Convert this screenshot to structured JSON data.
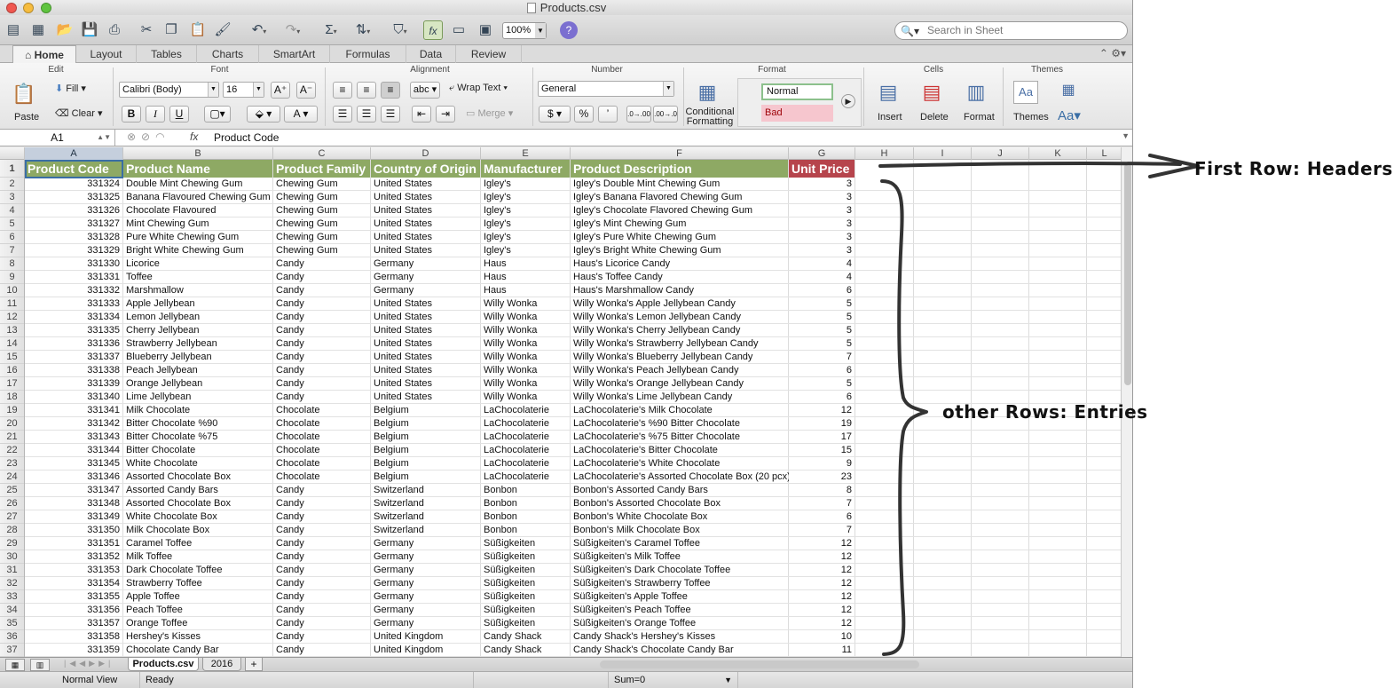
{
  "window": {
    "title": "Products.csv"
  },
  "toolbar": {
    "zoom": "100%",
    "search_placeholder": "Search in Sheet"
  },
  "ribbon_tabs": [
    "Home",
    "Layout",
    "Tables",
    "Charts",
    "SmartArt",
    "Formulas",
    "Data",
    "Review"
  ],
  "ribbon": {
    "groups": {
      "edit": "Edit",
      "font": "Font",
      "alignment": "Alignment",
      "number": "Number",
      "format": "Format",
      "cells": "Cells",
      "themes": "Themes"
    },
    "paste": "Paste",
    "fill": "Fill",
    "clear": "Clear",
    "font_name": "Calibri (Body)",
    "font_size": "16",
    "bold": "B",
    "italic": "I",
    "underline": "U",
    "abc": "abc",
    "wrap_text": "Wrap Text",
    "merge": "Merge",
    "number_format": "General",
    "percent": "%",
    "comma": "’",
    "inc_dec": ".0→.00",
    "dec_dec": ".00→.0",
    "conditional_formatting_1": "Conditional",
    "conditional_formatting_2": "Formatting",
    "style_normal": "Normal",
    "style_bad": "Bad",
    "insert": "Insert",
    "delete": "Delete",
    "format": "Format",
    "themes": "Themes",
    "aa": "Aa"
  },
  "formula_bar": {
    "cell_ref": "A1",
    "fx": "fx",
    "value": "Product Code"
  },
  "columns": [
    "A",
    "B",
    "C",
    "D",
    "E",
    "F",
    "G",
    "H",
    "I",
    "J",
    "K",
    "L"
  ],
  "headers": [
    "Product Code",
    "Product Name",
    "Product Family",
    "Country of Origin",
    "Manufacturer",
    "Product Description",
    "Unit Price"
  ],
  "rows": [
    [
      "331324",
      "Double Mint Chewing Gum",
      "Chewing Gum",
      "United States",
      "Igley's",
      "Igley's Double Mint Chewing Gum",
      "3"
    ],
    [
      "331325",
      "Banana Flavoured Chewing Gum",
      "Chewing Gum",
      "United States",
      "Igley's",
      "Igley's Banana Flavored Chewing Gum",
      "3"
    ],
    [
      "331326",
      "Chocolate Flavoured",
      "Chewing Gum",
      "United States",
      "Igley's",
      "Igley's Chocolate Flavored Chewing Gum",
      "3"
    ],
    [
      "331327",
      "Mint Chewing Gum",
      "Chewing Gum",
      "United States",
      "Igley's",
      "Igley's Mint Chewing Gum",
      "3"
    ],
    [
      "331328",
      "Pure White Chewing Gum",
      "Chewing Gum",
      "United States",
      "Igley's",
      "Igley's Pure White Chewing Gum",
      "3"
    ],
    [
      "331329",
      "Bright White Chewing Gum",
      "Chewing Gum",
      "United States",
      "Igley's",
      "Igley's Bright White Chewing Gum",
      "3"
    ],
    [
      "331330",
      "Licorice",
      "Candy",
      "Germany",
      "Haus",
      "Haus's Licorice Candy",
      "4"
    ],
    [
      "331331",
      "Toffee",
      "Candy",
      "Germany",
      "Haus",
      "Haus's Toffee Candy",
      "4"
    ],
    [
      "331332",
      "Marshmallow",
      "Candy",
      "Germany",
      "Haus",
      "Haus's Marshmallow Candy",
      "6"
    ],
    [
      "331333",
      "Apple Jellybean",
      "Candy",
      "United States",
      "Willy Wonka",
      "Willy Wonka's Apple Jellybean Candy",
      "5"
    ],
    [
      "331334",
      "Lemon Jellybean",
      "Candy",
      "United States",
      "Willy Wonka",
      "Willy Wonka's Lemon Jellybean Candy",
      "5"
    ],
    [
      "331335",
      "Cherry Jellybean",
      "Candy",
      "United States",
      "Willy Wonka",
      "Willy Wonka's Cherry Jellybean Candy",
      "5"
    ],
    [
      "331336",
      "Strawberry Jellybean",
      "Candy",
      "United States",
      "Willy Wonka",
      "Willy Wonka's Strawberry Jellybean Candy",
      "5"
    ],
    [
      "331337",
      "Blueberry Jellybean",
      "Candy",
      "United States",
      "Willy Wonka",
      "Willy Wonka's Blueberry Jellybean Candy",
      "7"
    ],
    [
      "331338",
      "Peach Jellybean",
      "Candy",
      "United States",
      "Willy Wonka",
      "Willy Wonka's Peach Jellybean Candy",
      "6"
    ],
    [
      "331339",
      "Orange Jellybean",
      "Candy",
      "United States",
      "Willy Wonka",
      "Willy Wonka's Orange Jellybean Candy",
      "5"
    ],
    [
      "331340",
      "Lime Jellybean",
      "Candy",
      "United States",
      "Willy Wonka",
      "Willy Wonka's Lime Jellybean Candy",
      "6"
    ],
    [
      "331341",
      "Milk Chocolate",
      "Chocolate",
      "Belgium",
      "LaChocolaterie",
      "LaChocolaterie's Milk Chocolate",
      "12"
    ],
    [
      "331342",
      "Bitter Chocolate %90",
      "Chocolate",
      "Belgium",
      "LaChocolaterie",
      "LaChocolaterie's %90 Bitter Chocolate",
      "19"
    ],
    [
      "331343",
      "Bitter Chocolate %75",
      "Chocolate",
      "Belgium",
      "LaChocolaterie",
      "LaChocolaterie's %75 Bitter Chocolate",
      "17"
    ],
    [
      "331344",
      "Bitter Chocolate",
      "Chocolate",
      "Belgium",
      "LaChocolaterie",
      "LaChocolaterie's Bitter Chocolate",
      "15"
    ],
    [
      "331345",
      "White Chocolate",
      "Chocolate",
      "Belgium",
      "LaChocolaterie",
      "LaChocolaterie's White Chocolate",
      "9"
    ],
    [
      "331346",
      "Assorted Chocolate Box",
      "Chocolate",
      "Belgium",
      "LaChocolaterie",
      "LaChocolaterie's Assorted Chocolate Box (20 pcx)",
      "23"
    ],
    [
      "331347",
      "Assorted Candy Bars",
      "Candy",
      "Switzerland",
      "Bonbon",
      "Bonbon's Assorted Candy Bars",
      "8"
    ],
    [
      "331348",
      "Assorted Chocolate Box",
      "Candy",
      "Switzerland",
      "Bonbon",
      "Bonbon's Assorted Chocolate Box",
      "7"
    ],
    [
      "331349",
      "White Chocolate Box",
      "Candy",
      "Switzerland",
      "Bonbon",
      "Bonbon's White Chocolate Box",
      "6"
    ],
    [
      "331350",
      "Milk Chocolate Box",
      "Candy",
      "Switzerland",
      "Bonbon",
      "Bonbon's Milk Chocolate Box",
      "7"
    ],
    [
      "331351",
      "Caramel Toffee",
      "Candy",
      "Germany",
      "Süßigkeiten",
      "Süßigkeiten's Caramel Toffee",
      "12"
    ],
    [
      "331352",
      "Milk Toffee",
      "Candy",
      "Germany",
      "Süßigkeiten",
      "Süßigkeiten's Milk Toffee",
      "12"
    ],
    [
      "331353",
      "Dark Chocolate Toffee",
      "Candy",
      "Germany",
      "Süßigkeiten",
      "Süßigkeiten's Dark Chocolate Toffee",
      "12"
    ],
    [
      "331354",
      "Strawberry Toffee",
      "Candy",
      "Germany",
      "Süßigkeiten",
      "Süßigkeiten's Strawberry Toffee",
      "12"
    ],
    [
      "331355",
      "Apple Toffee",
      "Candy",
      "Germany",
      "Süßigkeiten",
      "Süßigkeiten's Apple Toffee",
      "12"
    ],
    [
      "331356",
      "Peach Toffee",
      "Candy",
      "Germany",
      "Süßigkeiten",
      "Süßigkeiten's Peach Toffee",
      "12"
    ],
    [
      "331357",
      "Orange Toffee",
      "Candy",
      "Germany",
      "Süßigkeiten",
      "Süßigkeiten's Orange Toffee",
      "12"
    ],
    [
      "331358",
      "Hershey's Kisses",
      "Candy",
      "United Kingdom",
      "Candy Shack",
      "Candy Shack's Hershey's Kisses",
      "10"
    ],
    [
      "331359",
      "Chocolate Candy Bar",
      "Candy",
      "United Kingdom",
      "Candy Shack",
      "Candy Shack's Chocolate Candy Bar",
      "11"
    ]
  ],
  "sheet_tabs": [
    "Products.csv",
    "2016"
  ],
  "add_sheet": "+",
  "status": {
    "view": "Normal View",
    "state": "Ready",
    "sum": "Sum=0"
  },
  "annotations": {
    "headers_note": "First Row: Headers",
    "entries_note": "other Rows: Entries"
  },
  "colors": {
    "header_bg": "#8ea964",
    "price_header_bg": "#b6444c",
    "selection": "#3a6ea5",
    "annotation_ink": "#111111"
  }
}
